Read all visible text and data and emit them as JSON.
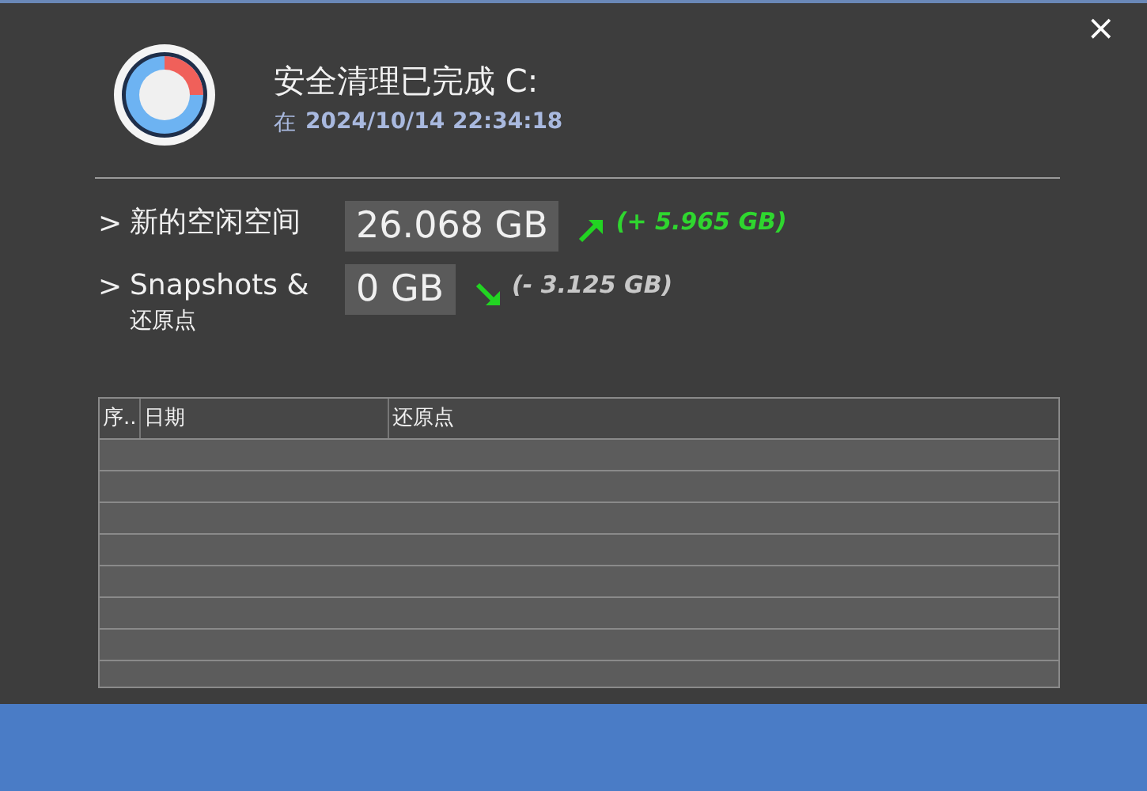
{
  "window": {
    "close": "×"
  },
  "header": {
    "title": "安全清理已完成 C:",
    "prefix": "在",
    "datetime": "2024/10/14 22:34:18"
  },
  "stats": [
    {
      "marker": ">",
      "label": "新的空闲空间",
      "value": "26.068 GB",
      "kind": "increase",
      "change": "(+ 5.965 GB)"
    },
    {
      "marker": ">",
      "label": "Snapshots &",
      "label_line2": "还原点",
      "value": "0 GB",
      "kind": "decrease",
      "change": "(- 3.125 GB)"
    }
  ],
  "table": {
    "columns": [
      "序..",
      "日期",
      "还原点"
    ]
  }
}
